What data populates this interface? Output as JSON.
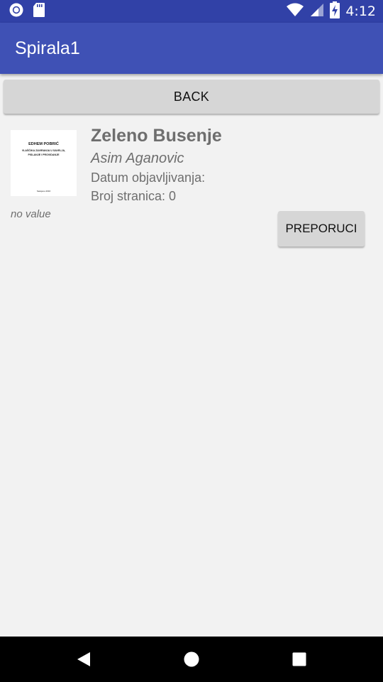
{
  "status_bar": {
    "time": "4:12",
    "icons": [
      "notification-circle-icon",
      "sd-card-icon",
      "wifi-icon",
      "signal-icon",
      "battery-charging-icon"
    ],
    "color": "#3141a7"
  },
  "app_bar": {
    "title": "Spirala1",
    "color": "#3f51b5"
  },
  "actions": {
    "back_label": "BACK",
    "recommend_label": "PREPORUCI"
  },
  "book": {
    "cover": {
      "author": "EDHEM POBRIĆ",
      "title_line1": "VLAŠČIKA ZAVIRANJA U SAVELJA,",
      "title_line2": "PISLANJE I PROVIDANJE",
      "footer": "Sarajevo 2016"
    },
    "title": "Zeleno Busenje",
    "author": "Asim Aganovic",
    "date_line": "Datum objavljivanja:",
    "pages_line": "Broj stranica: 0",
    "description": "no value"
  },
  "nav_bar": {
    "buttons": [
      "back-triangle-icon",
      "home-circle-icon",
      "recents-square-icon"
    ]
  }
}
